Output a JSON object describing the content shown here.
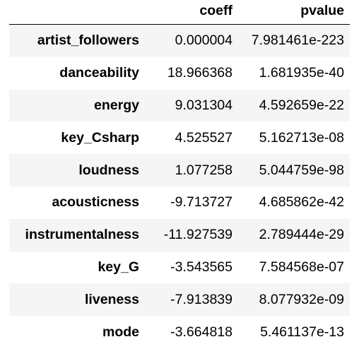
{
  "table": {
    "index_header": "",
    "columns": [
      "coeff",
      "pvalue"
    ],
    "rows": [
      {
        "index": "artist_followers",
        "coeff": "0.000004",
        "pvalue": "7.981461e-223"
      },
      {
        "index": "danceability",
        "coeff": "18.966368",
        "pvalue": "1.681935e-40"
      },
      {
        "index": "energy",
        "coeff": "9.031304",
        "pvalue": "4.592659e-22"
      },
      {
        "index": "key_Csharp",
        "coeff": "4.525527",
        "pvalue": "5.162713e-08"
      },
      {
        "index": "loudness",
        "coeff": "1.077258",
        "pvalue": "5.044759e-98"
      },
      {
        "index": "acousticness",
        "coeff": "-9.713727",
        "pvalue": "4.685862e-42"
      },
      {
        "index": "instrumentalness",
        "coeff": "-11.927539",
        "pvalue": "2.789444e-29"
      },
      {
        "index": "key_G",
        "coeff": "-3.543565",
        "pvalue": "7.584568e-07"
      },
      {
        "index": "liveness",
        "coeff": "-7.913839",
        "pvalue": "8.077932e-09"
      },
      {
        "index": "mode",
        "coeff": "-3.664818",
        "pvalue": "5.461137e-13"
      }
    ]
  }
}
